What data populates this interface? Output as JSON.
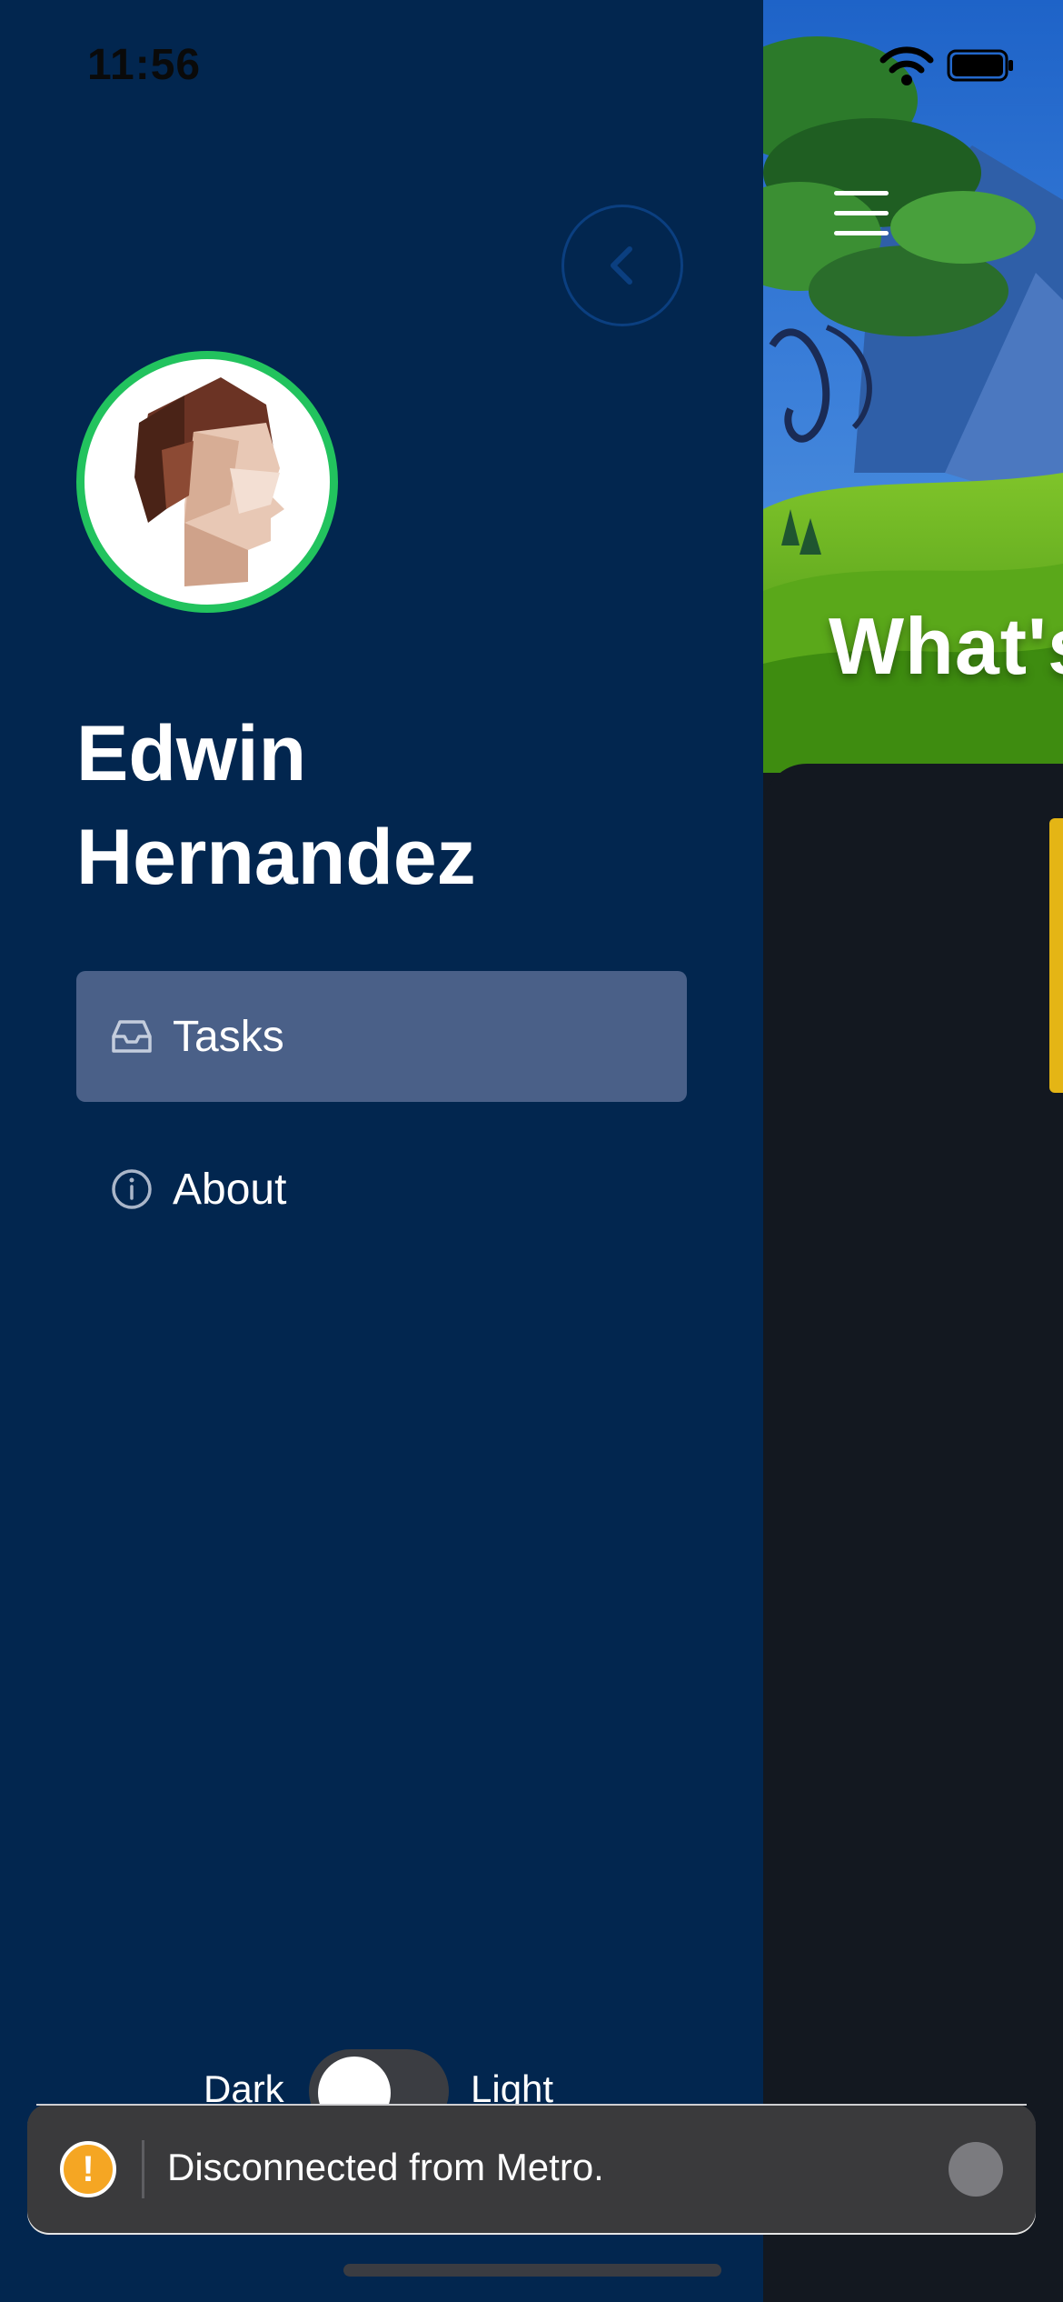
{
  "status_bar": {
    "time": "11:56",
    "icons": [
      "wifi-icon",
      "battery-icon"
    ]
  },
  "drawer": {
    "back_icon": "chevron-left-icon",
    "user": {
      "name_line1": "Edwin",
      "name_line2": "Hernandez",
      "avatar_icon": "low-poly-portrait"
    },
    "items": [
      {
        "label": "Tasks",
        "icon": "inbox-icon",
        "active": true
      },
      {
        "label": "About",
        "icon": "info-icon",
        "active": false
      }
    ],
    "theme": {
      "dark_label": "Dark",
      "light_label": "Light",
      "mode": "dark"
    }
  },
  "main": {
    "hero_title": "What's",
    "menu_icon": "hamburger-icon"
  },
  "toast": {
    "message": "Disconnected from Metro.",
    "icon": "warning-icon"
  },
  "colors": {
    "drawer_bg": "#02264f",
    "active_item_bg": "#4a6088",
    "avatar_ring": "#22c35e",
    "accent_yellow": "#e4b515",
    "toast_bg": "#3a3a3c",
    "warning": "#f5a623"
  }
}
